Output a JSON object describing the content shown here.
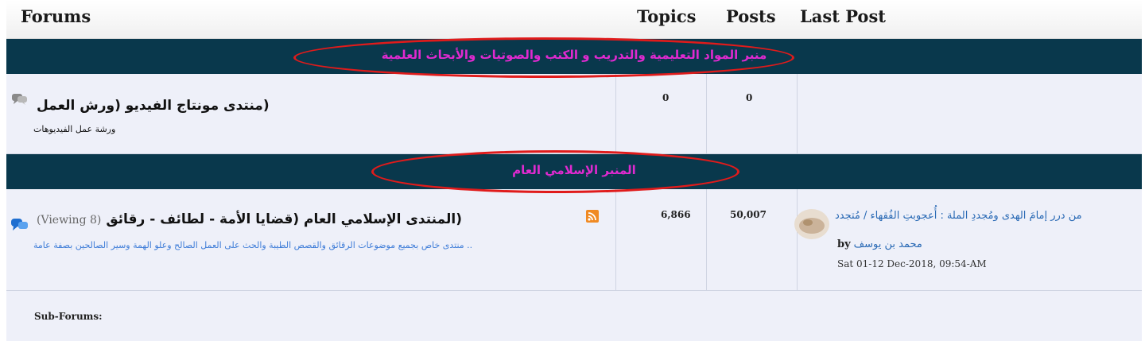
{
  "header": {
    "forums": "Forums",
    "topics": "Topics",
    "posts": "Posts",
    "last_post": "Last Post"
  },
  "categories": [
    {
      "title": "منبر المواد التعليمية والتدريب و الكتب والصوتيات والأبحاث العلمية"
    },
    {
      "title": "المنبر الإسلامي العام"
    }
  ],
  "forums": [
    {
      "title": "(منتدى مونتاج الفيديو (ورش العمل",
      "description": "ورشة عمل الفيديوهات",
      "topics": "0",
      "posts": "0",
      "icon": "speech-bubble-gray-icon"
    },
    {
      "title": "(المنتدى الإسلامي العام (قضايا الأمة - لطائف - رقائق",
      "viewing": "(8 Viewing)",
      "description": ".. منتدى خاص بجميع موضوعات الرقائق والقصص الطيبة والحث على العمل الصالح وعلو الهمة وسير الصالحين بصفة عامة",
      "topics": "6,866",
      "posts": "50,007",
      "icon": "speech-bubble-blue-icon",
      "rss_icon": "rss-icon",
      "last_post": {
        "title": "من درر إمامَ الهدى ومُجددِ الملة : أُعجوبتِ الفُقهاء / مُتجدد",
        "by_label": "by",
        "author": "محمد بن يوسف",
        "date": "Sat 01-12 Dec-2018, 09:54-AM"
      }
    }
  ],
  "subforums_label": "Sub-Forums:",
  "colors": {
    "category_bg": "#09384c",
    "category_text": "#e02ad0",
    "row_bg": "#eef0f9",
    "link": "#2a6ab5",
    "annotation": "#e01b1b"
  }
}
